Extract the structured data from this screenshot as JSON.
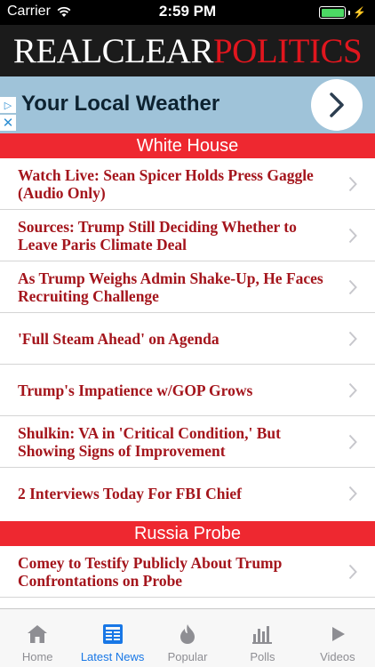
{
  "status_bar": {
    "carrier": "Carrier",
    "time": "2:59 PM",
    "battery_level": 1.0
  },
  "header": {
    "logo_part1": "REALCLEAR",
    "logo_part2": "POLITICS"
  },
  "ad": {
    "text": "Your Local Weather"
  },
  "sections": [
    {
      "title": "White House",
      "items": [
        {
          "title": "Watch Live: Sean Spicer Holds Press Gaggle (Audio Only)"
        },
        {
          "title": "Sources: Trump Still Deciding Whether to Leave Paris Climate Deal"
        },
        {
          "title": "As Trump Weighs Admin Shake-Up, He Faces Recruiting Challenge"
        },
        {
          "title": "'Full Steam Ahead' on Agenda"
        },
        {
          "title": "Trump's Impatience w/GOP Grows"
        },
        {
          "title": "Shulkin: VA in 'Critical Condition,' But Showing Signs of Improvement"
        },
        {
          "title": "2 Interviews Today For FBI Chief"
        }
      ]
    },
    {
      "title": "Russia Probe",
      "items": [
        {
          "title": "Comey to Testify Publicly About Trump Confrontations on Probe"
        }
      ]
    }
  ],
  "tabs": [
    {
      "label": "Home",
      "icon": "house-icon",
      "active": false
    },
    {
      "label": "Latest News",
      "icon": "newspaper-icon",
      "active": true
    },
    {
      "label": "Popular",
      "icon": "flame-icon",
      "active": false
    },
    {
      "label": "Polls",
      "icon": "bar-chart-icon",
      "active": false
    },
    {
      "label": "Videos",
      "icon": "play-icon",
      "active": false
    }
  ],
  "colors": {
    "brand_red": "#ee2830",
    "headline_red": "#a4151c",
    "active_tab": "#1877e6",
    "inactive_tab": "#8e8e93"
  }
}
